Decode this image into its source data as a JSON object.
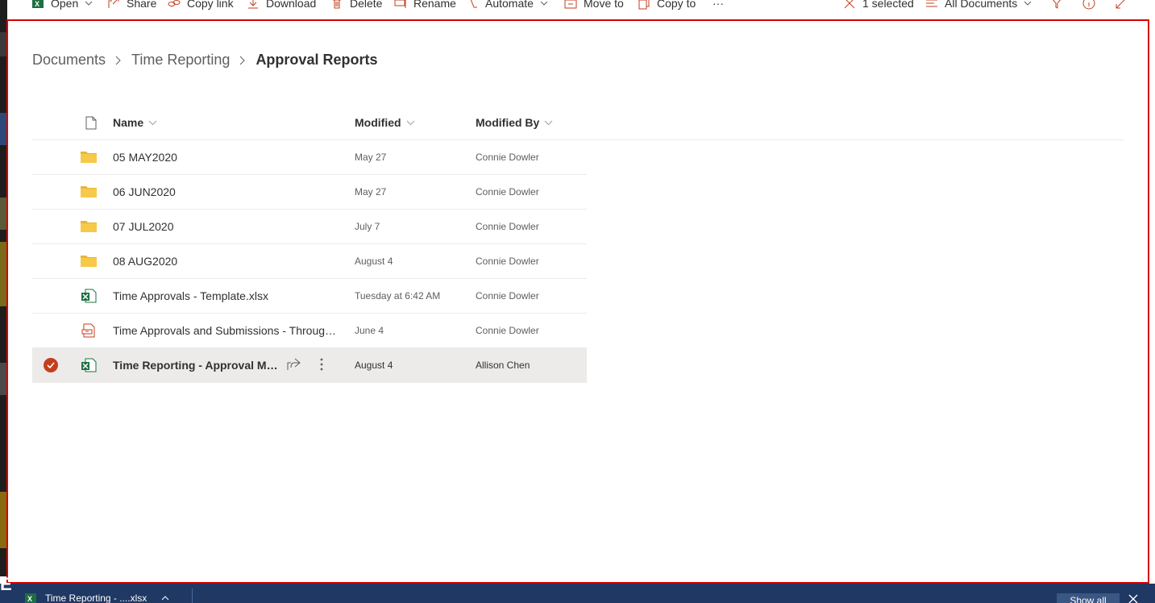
{
  "commandbar": {
    "open": "Open",
    "share": "Share",
    "copy_link": "Copy link",
    "download": "Download",
    "delete": "Delete",
    "rename": "Rename",
    "automate": "Automate",
    "move_to": "Move to",
    "copy_to": "Copy to",
    "more": "···",
    "selection": "1 selected",
    "view": "All Documents"
  },
  "breadcrumb": {
    "items": [
      "Documents",
      "Time Reporting"
    ],
    "current": "Approval Reports"
  },
  "columns": {
    "name": "Name",
    "modified": "Modified",
    "modified_by": "Modified By"
  },
  "files": [
    {
      "type": "folder",
      "name": "05 MAY2020",
      "modified": "May 27",
      "modified_by": "Connie Dowler",
      "selected": false
    },
    {
      "type": "folder",
      "name": "06 JUN2020",
      "modified": "May 27",
      "modified_by": "Connie Dowler",
      "selected": false
    },
    {
      "type": "folder",
      "name": "07 JUL2020",
      "modified": "July 7",
      "modified_by": "Connie Dowler",
      "selected": false
    },
    {
      "type": "folder",
      "name": "08 AUG2020",
      "modified": "August 4",
      "modified_by": "Connie Dowler",
      "selected": false
    },
    {
      "type": "excel",
      "name": "Time Approvals - Template.xlsx",
      "modified": "Tuesday at 6:42 AM",
      "modified_by": "Connie Dowler",
      "selected": false
    },
    {
      "type": "pdf",
      "name": "Time Approvals and Submissions - Through...",
      "modified": "June 4",
      "modified_by": "Connie Dowler",
      "selected": false
    },
    {
      "type": "excel",
      "name": "Time Reporting - Approval Ma...",
      "modified": "August 4",
      "modified_by": "Allison Chen",
      "selected": true
    }
  ],
  "download_bar": {
    "file": "Time Reporting - ....xlsx",
    "show_all": "Show all"
  },
  "colors": {
    "accent": "#c43e1c",
    "panel_border": "#d90000",
    "folder": "#f7c948",
    "excel": "#1d6f42",
    "download_bar": "#1f3864"
  }
}
